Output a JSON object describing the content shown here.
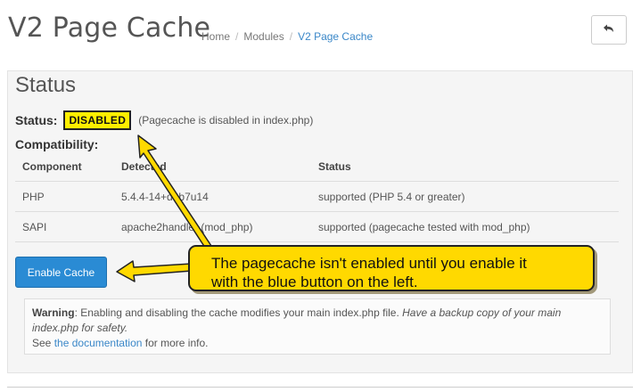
{
  "header": {
    "title": "V2 Page Cache",
    "breadcrumb": [
      "Home",
      "Modules",
      "V2 Page Cache"
    ]
  },
  "panel": {
    "title": "Status",
    "status_label": "Status:",
    "status_badge": "DISABLED",
    "status_note": "(Pagecache is disabled in index.php)",
    "compatibility_label": "Compatibility:",
    "table": {
      "headers": [
        "Component",
        "Detected",
        "Status"
      ],
      "rows": [
        [
          "PHP",
          "5.4.4-14+deb7u14",
          "supported (PHP 5.4 or greater)"
        ],
        [
          "SAPI",
          "apache2handler (mod_php)",
          "supported (pagecache tested with mod_php)"
        ]
      ]
    },
    "enable_button": "Enable Cache",
    "warning": {
      "label": "Warning",
      "text": ": Enabling and disabling the cache modifies your main index.php file.",
      "italic": "Have a backup copy of your main index.php for safety.",
      "see": "See",
      "link": "the documentation",
      "after": "for more info."
    }
  },
  "callout": {
    "line1": "The pagecache isn't enabled until you enable it",
    "line2": "with the blue button on the left."
  },
  "colors": {
    "accent_blue": "#2a8bd4",
    "badge_yellow": "#ffef00",
    "callout_yellow": "#ffd900"
  },
  "icons": {
    "back": "undo-arrow-icon"
  }
}
